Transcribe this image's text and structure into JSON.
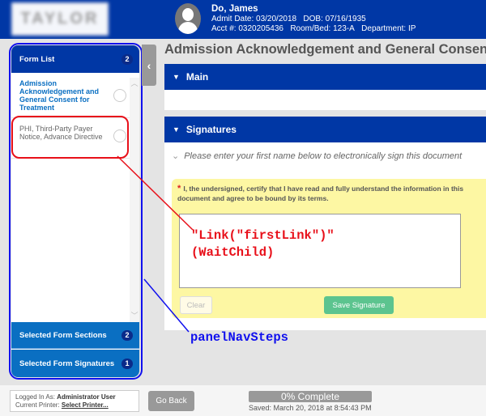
{
  "header": {
    "logo_text": "TAYLOR",
    "patient_name": "Do, James",
    "admit_date": "Admit Date: 03/20/2018",
    "dob": "DOB: 07/16/1935",
    "acct": "Acct #: 0320205436",
    "room": "Room/Bed: 123-A",
    "department": "Department: IP"
  },
  "sidebar": {
    "form_list_label": "Form List",
    "form_list_count": "2",
    "items": [
      {
        "label": "Admission Acknowledgement and General Consent for Treatment",
        "active": true
      },
      {
        "label": "PHI, Third-Party Payer Notice, Advance Directive",
        "active": false
      }
    ],
    "sections_label": "Selected Form Sections",
    "sections_count": "2",
    "signatures_label": "Selected Form Signatures",
    "signatures_count": "1"
  },
  "main": {
    "title": "Admission Acknowledgement and General Consent",
    "main_section": "Main",
    "signatures_section": "Signatures",
    "instruction": "Please enter your first name below to electronically sign this document",
    "certify": "I, the undersigned, certify that I have read and fully understand the information in this document and agree to be bound by its terms.",
    "clear_label": "Clear",
    "save_label": "Save Signature"
  },
  "annotations": {
    "link_line1": "\"Link(\"firstLink\")\"",
    "link_line2": "(WaitChild)",
    "panel_label": "panelNavSteps"
  },
  "footer": {
    "logged_in_label": "Logged In As:",
    "logged_in_user": "Administrator User",
    "printer_label": "Current Printer:",
    "printer_value": "Select Printer...",
    "go_back_label": "Go Back",
    "progress_text": "0% Complete",
    "progress_percent": 0,
    "saved": "Saved: March 20, 2018 at 8:54:43 PM"
  },
  "colors": {
    "header": "#0037a5",
    "section_bar": "#0a6fc2",
    "save": "#5cc48f",
    "annotation_red": "#e8101a",
    "annotation_blue": "#1010ee"
  }
}
